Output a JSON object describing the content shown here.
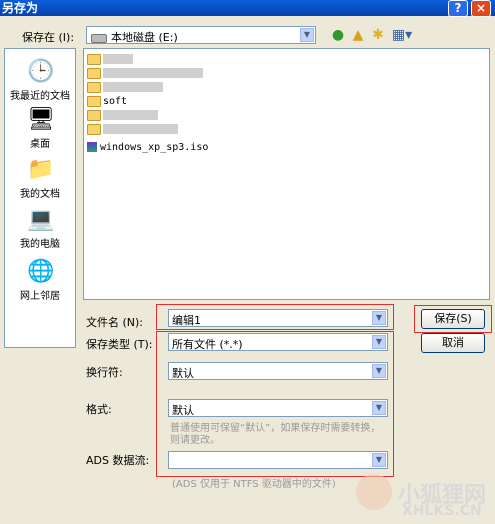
{
  "window": {
    "title": "另存为",
    "help_label": "?",
    "close_label": "×"
  },
  "toolbar": {
    "save_in_label": "保存在 (I):",
    "save_in_value": "本地磁盘 (E:)",
    "icons": [
      "back-icon",
      "up-folder-icon",
      "new-folder-icon",
      "view-menu-icon"
    ]
  },
  "places": [
    {
      "label": "我最近的文档",
      "icon": "recent-documents-icon"
    },
    {
      "label": "桌面",
      "icon": "desktop-icon"
    },
    {
      "label": "我的文档",
      "icon": "my-documents-icon"
    },
    {
      "label": "我的电脑",
      "icon": "my-computer-icon"
    },
    {
      "label": "网上邻居",
      "icon": "network-icon"
    }
  ],
  "files": [
    {
      "name": "",
      "type": "folder"
    },
    {
      "name": "",
      "type": "folder"
    },
    {
      "name": "",
      "type": "folder"
    },
    {
      "name": "soft",
      "type": "folder"
    },
    {
      "name": "",
      "type": "folder"
    },
    {
      "name": "",
      "type": "folder"
    },
    {
      "name": "windows_xp_sp3.iso",
      "type": "archive"
    }
  ],
  "form": {
    "filename_label": "文件名 (N):",
    "filename_value": "编辑1",
    "filetype_label": "保存类型 (T):",
    "filetype_value": "所有文件 (*.*)",
    "linebreak_label": "换行符:",
    "linebreak_value": "默认",
    "format_label": "格式:",
    "format_value": "默认",
    "format_hint": "普通使用可保留“默认”，如果保存时需要转换，则请更改。",
    "ads_label": "ADS 数据流:",
    "ads_value": "",
    "ads_hint": "(ADS 仅用于 NTFS 驱动器中的文件)"
  },
  "buttons": {
    "save": "保存(S)",
    "cancel": "取消"
  },
  "watermark": {
    "cn": "小狐狸网",
    "url": "XHLKS.CN"
  },
  "colors": {
    "highlight_box": "#e03030",
    "title_bar": "#0a5fd8"
  }
}
